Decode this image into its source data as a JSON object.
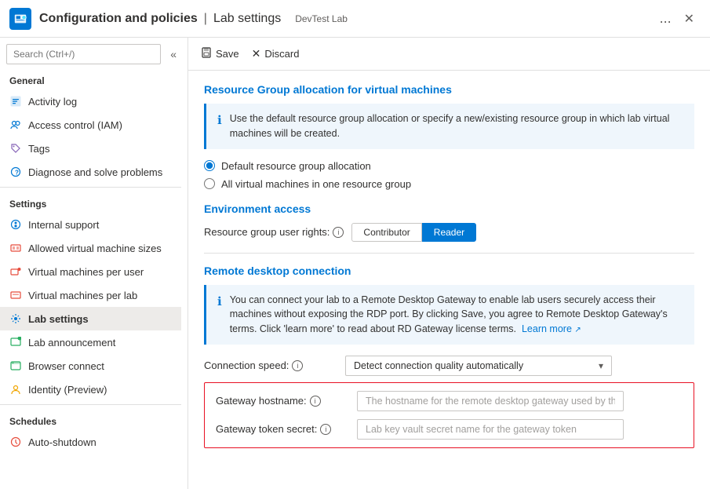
{
  "titleBar": {
    "icon": "lab-settings-icon",
    "mainTitle": "Configuration and policies",
    "separator": "|",
    "subTitle": "Lab settings",
    "subtitle2": "DevTest Lab",
    "ellipsis": "...",
    "closeLabel": "✕"
  },
  "sidebar": {
    "searchPlaceholder": "Search (Ctrl+/)",
    "collapseLabel": "«",
    "sections": [
      {
        "label": "General",
        "items": [
          {
            "id": "activity-log",
            "label": "Activity log",
            "icon": "activity-icon",
            "iconColor": "#0078d4"
          },
          {
            "id": "access-control",
            "label": "Access control (IAM)",
            "icon": "access-icon",
            "iconColor": "#0078d4"
          },
          {
            "id": "tags",
            "label": "Tags",
            "icon": "tags-icon",
            "iconColor": "#8764b8"
          },
          {
            "id": "diagnose",
            "label": "Diagnose and solve problems",
            "icon": "diagnose-icon",
            "iconColor": "#0078d4"
          }
        ]
      },
      {
        "label": "Settings",
        "items": [
          {
            "id": "internal-support",
            "label": "Internal support",
            "icon": "support-icon",
            "iconColor": "#0078d4"
          },
          {
            "id": "allowed-vm-sizes",
            "label": "Allowed virtual machine sizes",
            "icon": "vm-sizes-icon",
            "iconColor": "#e74c3c"
          },
          {
            "id": "vm-per-user",
            "label": "Virtual machines per user",
            "icon": "vm-user-icon",
            "iconColor": "#e74c3c"
          },
          {
            "id": "vm-per-lab",
            "label": "Virtual machines per lab",
            "icon": "vm-lab-icon",
            "iconColor": "#e74c3c"
          },
          {
            "id": "lab-settings",
            "label": "Lab settings",
            "icon": "lab-settings-icon",
            "iconColor": "#0078d4",
            "active": true
          },
          {
            "id": "lab-announcement",
            "label": "Lab announcement",
            "icon": "announcement-icon",
            "iconColor": "#27ae60"
          },
          {
            "id": "browser-connect",
            "label": "Browser connect",
            "icon": "browser-icon",
            "iconColor": "#27ae60"
          },
          {
            "id": "identity-preview",
            "label": "Identity (Preview)",
            "icon": "identity-icon",
            "iconColor": "#f0a500"
          }
        ]
      },
      {
        "label": "Schedules",
        "items": [
          {
            "id": "auto-shutdown",
            "label": "Auto-shutdown",
            "icon": "shutdown-icon",
            "iconColor": "#e74c3c"
          }
        ]
      }
    ]
  },
  "toolbar": {
    "saveLabel": "Save",
    "discardLabel": "Discard"
  },
  "content": {
    "resourceGroupTitle": "Resource Group allocation for virtual machines",
    "infoText": "Use the default resource group allocation or specify a new/existing resource group in which lab virtual machines will be created.",
    "radioOptions": [
      {
        "id": "default-rg",
        "label": "Default resource group allocation",
        "selected": true
      },
      {
        "id": "all-rg",
        "label": "All virtual machines in one resource group",
        "selected": false
      }
    ],
    "environmentAccessTitle": "Environment access",
    "resourceGroupUserRightsLabel": "Resource group user rights:",
    "toggleOptions": [
      {
        "id": "contributor",
        "label": "Contributor",
        "active": false
      },
      {
        "id": "reader",
        "label": "Reader",
        "active": true
      }
    ],
    "remoteDesktopTitle": "Remote desktop connection",
    "remoteDesktopInfo": "You can connect your lab to a Remote Desktop Gateway to enable lab users securely access their machines without exposing the RDP port. By clicking Save, you agree to Remote Desktop Gateway's terms. Click 'learn more' to read about RD Gateway license terms.",
    "learnMoreLabel": "Learn more",
    "connectionSpeedLabel": "Connection speed:",
    "connectionSpeedValue": "Detect connection quality automatically",
    "gatewayHostnameLabel": "Gateway hostname:",
    "gatewayHostnamePlaceholder": "The hostname for the remote desktop gateway used by this lab",
    "gatewayTokenLabel": "Gateway token secret:",
    "gatewayTokenPlaceholder": "Lab key vault secret name for the gateway token"
  }
}
